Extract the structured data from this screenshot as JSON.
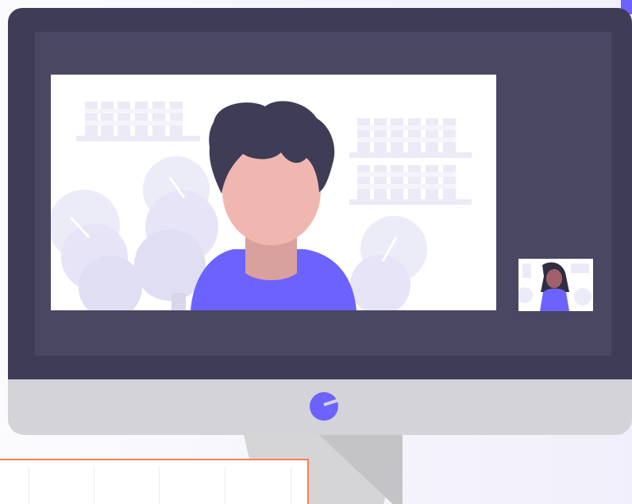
{
  "scene": {
    "kind": "video call illustration",
    "colors": {
      "monitor_frame": "#3f3d56",
      "screen": "#4a4763",
      "chin": "#d4d4d8",
      "accent": "#6c63ff",
      "overlay_border": "#ff7f50"
    }
  },
  "video_main": {
    "participant_shirt": "#6c63ff",
    "participant_skin": "#f0b7b1",
    "hair": "#2f2e41"
  },
  "video_thumb": {
    "participant_shirt": "#6c63ff",
    "participant_skin": "#a0616a",
    "hair": "#2f2e41"
  },
  "overlay_panel": {
    "columns": 5
  }
}
